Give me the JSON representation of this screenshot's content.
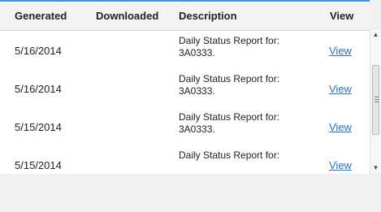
{
  "table": {
    "headers": {
      "generated": "Generated",
      "downloaded": "Downloaded",
      "description": "Description",
      "view": "View"
    },
    "rows": [
      {
        "generated": "5/16/2014",
        "downloaded": "",
        "description_line1": "Daily Status Report for:",
        "description_line2": "3A0333.",
        "view": "View"
      },
      {
        "generated": "5/16/2014",
        "downloaded": "",
        "description_line1": "Daily Status Report for:",
        "description_line2": "3A0333.",
        "view": "View"
      },
      {
        "generated": "5/15/2014",
        "downloaded": "",
        "description_line1": "Daily Status Report for:",
        "description_line2": "3A0333.",
        "view": "View"
      },
      {
        "generated": "5/15/2014",
        "downloaded": "",
        "description_line1": "Daily Status Report for:",
        "description_line2": "",
        "view": "View"
      }
    ]
  },
  "scrollbar": {
    "up_icon": "arrow-up-icon",
    "down_icon": "arrow-down-icon"
  },
  "colors": {
    "link": "#2a6ebb",
    "accent_border": "#4a90d9"
  }
}
